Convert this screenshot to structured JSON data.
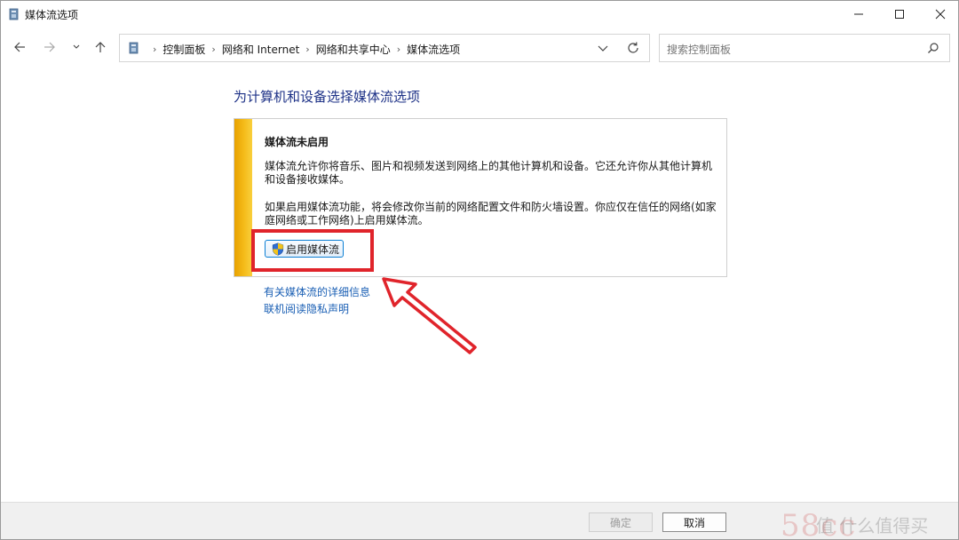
{
  "window": {
    "title": "媒体流选项"
  },
  "nav": {
    "back_icon": "arrow-left-icon",
    "forward_icon": "arrow-right-icon",
    "recent_icon": "chevron-down-icon",
    "up_icon": "arrow-up-icon"
  },
  "address": {
    "crumbs": [
      "控制面板",
      "网络和 Internet",
      "网络和共享中心",
      "媒体流选项"
    ]
  },
  "search": {
    "placeholder": "搜索控制面板"
  },
  "content": {
    "heading": "为计算机和设备选择媒体流选项",
    "panel": {
      "title": "媒体流未启用",
      "paragraph1": "媒体流允许你将音乐、图片和视频发送到网络上的其他计算机和设备。它还允许你从其他计算机和设备接收媒体。",
      "paragraph2": "如果启用媒体流功能，将会修改你当前的网络配置文件和防火墙设置。你应仅在信任的网络(如家庭网络或工作网络)上启用媒体流。",
      "enable_button": "启用媒体流",
      "accent_color": "#f2b20c"
    },
    "links": [
      "有关媒体流的详细信息",
      "联机阅读隐私声明"
    ]
  },
  "footer": {
    "ok_label": "确定",
    "cancel_label": "取消"
  },
  "annotation": {
    "highlight_color": "#e0242b"
  },
  "watermark": {
    "text": "58cc",
    "text2": "值 什么值得买"
  }
}
